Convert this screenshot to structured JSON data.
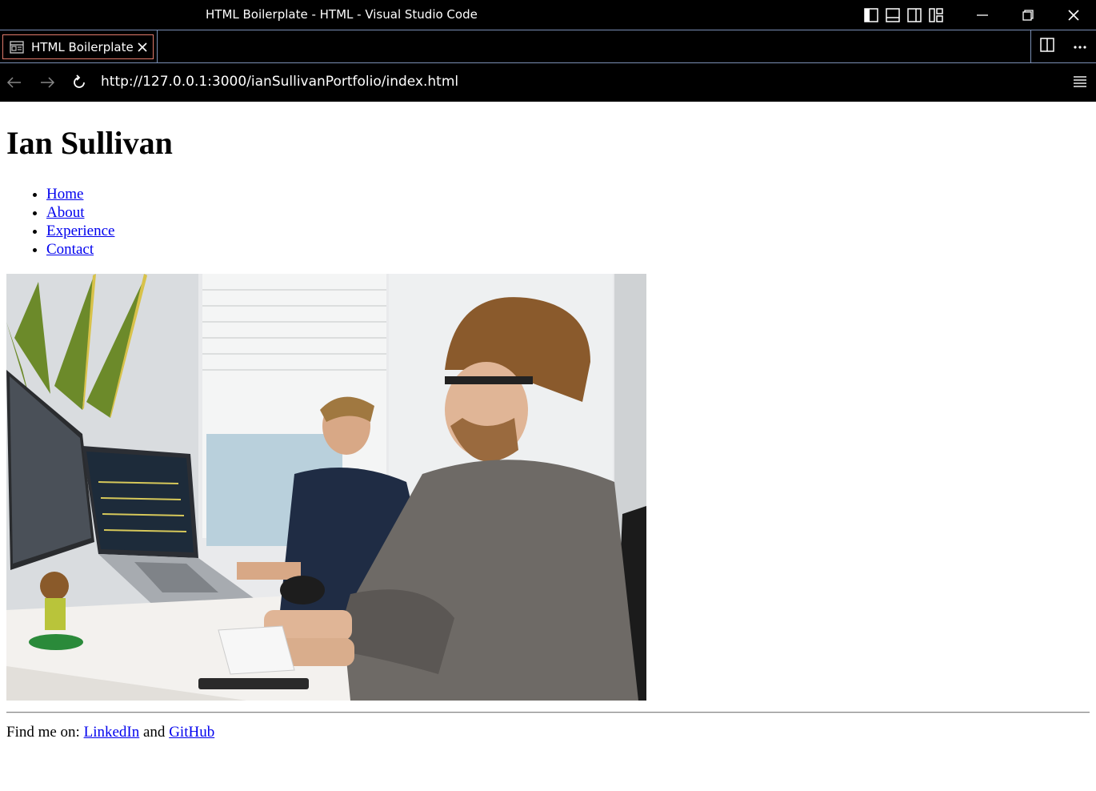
{
  "window": {
    "title": "HTML Boilerplate - HTML - Visual Studio Code"
  },
  "tab": {
    "label": "HTML Boilerplate"
  },
  "browser": {
    "url": "http://127.0.0.1:3000/ianSullivanPortfolio/index.html"
  },
  "page": {
    "heading": "Ian Sullivan",
    "nav": [
      {
        "label": "Home"
      },
      {
        "label": "About"
      },
      {
        "label": "Experience"
      },
      {
        "label": "Contact"
      }
    ],
    "footer": {
      "prefix": "Find me on: ",
      "linkedin": "LinkedIn",
      "and": " and ",
      "github": "GitHub"
    }
  },
  "colors": {
    "chrome_bg": "#000000",
    "accent_border": "#7a8fb5",
    "tab_border": "#e07a6a",
    "link": "#0000ee"
  }
}
